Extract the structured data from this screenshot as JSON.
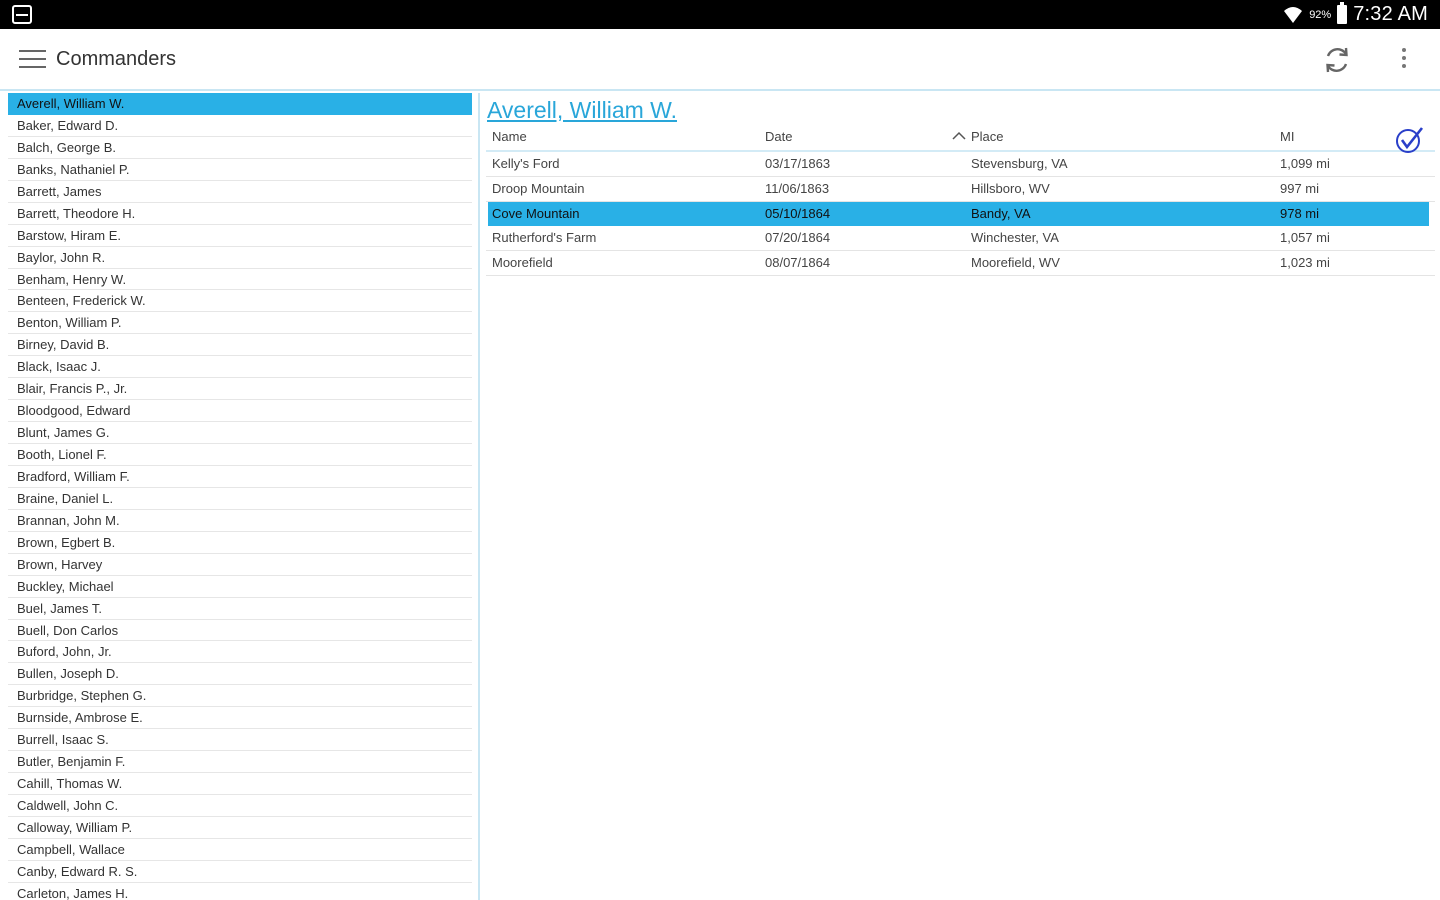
{
  "status_bar": {
    "battery_percent": "92%",
    "time": "7:32 AM"
  },
  "action_bar": {
    "title": "Commanders"
  },
  "commanders": [
    "Averell, William W.",
    "Baker, Edward D.",
    "Balch, George B.",
    "Banks, Nathaniel P.",
    "Barrett, James",
    "Barrett, Theodore H.",
    "Barstow, Hiram E.",
    "Baylor, John R.",
    "Benham, Henry W.",
    "Benteen, Frederick W.",
    "Benton, William P.",
    "Birney, David B.",
    "Black, Isaac J.",
    "Blair, Francis P., Jr.",
    "Bloodgood, Edward",
    "Blunt, James G.",
    "Booth, Lionel F.",
    "Bradford, William F.",
    "Braine, Daniel L.",
    "Brannan, John M.",
    "Brown, Egbert B.",
    "Brown, Harvey",
    "Buckley, Michael",
    "Buel, James T.",
    "Buell, Don Carlos",
    "Buford, John, Jr.",
    "Bullen, Joseph D.",
    "Burbridge, Stephen G.",
    "Burnside, Ambrose E.",
    "Burrell, Isaac S.",
    "Butler, Benjamin F.",
    "Cahill, Thomas W.",
    "Caldwell, John C.",
    "Calloway, William P.",
    "Campbell, Wallace",
    "Canby, Edward R. S.",
    "Carleton, James H."
  ],
  "selected_commander_index": 0,
  "detail": {
    "title": "Averell, William W.",
    "columns": {
      "name": "Name",
      "date": "Date",
      "place": "Place",
      "mi": "MI"
    },
    "sorted_column": "place",
    "selected_row_index": 2,
    "rows": [
      {
        "name": "Kelly's Ford",
        "date": "03/17/1863",
        "place": "Stevensburg, VA",
        "mi": "1,099 mi"
      },
      {
        "name": "Droop Mountain",
        "date": "11/06/1863",
        "place": "Hillsboro, WV",
        "mi": "997 mi"
      },
      {
        "name": "Cove Mountain",
        "date": "05/10/1864",
        "place": "Bandy, VA",
        "mi": "978 mi"
      },
      {
        "name": "Rutherford's Farm",
        "date": "07/20/1864",
        "place": "Winchester, VA",
        "mi": "1,057 mi"
      },
      {
        "name": "Moorefield",
        "date": "08/07/1864",
        "place": "Moorefield, WV",
        "mi": "1,023 mi"
      }
    ]
  },
  "colors": {
    "accent": "#29b0e6",
    "title_link": "#29a6d9",
    "check_icon": "#2a3fc9"
  }
}
